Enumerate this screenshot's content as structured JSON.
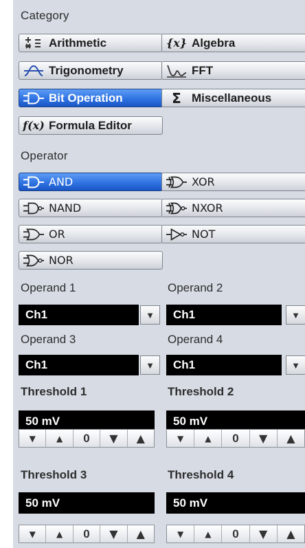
{
  "category": {
    "label": "Category",
    "items": [
      {
        "label": "Arithmetic",
        "icon": "plus-minus-icon"
      },
      {
        "label": "Algebra",
        "icon": "fx-braces-icon"
      },
      {
        "label": "Trigonometry",
        "icon": "sine-wave-icon"
      },
      {
        "label": "FFT",
        "icon": "fft-spectrum-icon"
      },
      {
        "label": "Bit Operation",
        "icon": "logic-gate-icon",
        "selected": true
      },
      {
        "label": "Miscellaneous",
        "icon": "sigma-icon"
      },
      {
        "label": "Formula Editor",
        "icon": "function-icon"
      }
    ]
  },
  "operator": {
    "label": "Operator",
    "items": [
      {
        "label": "AND",
        "icon": "and-gate-icon",
        "selected": true
      },
      {
        "label": "XOR",
        "icon": "xor-gate-icon"
      },
      {
        "label": "NAND",
        "icon": "nand-gate-icon"
      },
      {
        "label": "NXOR",
        "icon": "nxor-gate-icon"
      },
      {
        "label": "OR",
        "icon": "or-gate-icon"
      },
      {
        "label": "NOT",
        "icon": "not-gate-icon"
      },
      {
        "label": "NOR",
        "icon": "nor-gate-icon"
      }
    ]
  },
  "operands": [
    {
      "label": "Operand 1",
      "value": "Ch1"
    },
    {
      "label": "Operand 2",
      "value": "Ch1"
    },
    {
      "label": "Operand 3",
      "value": "Ch1"
    },
    {
      "label": "Operand 4",
      "value": "Ch1"
    }
  ],
  "thresholds": [
    {
      "label": "Threshold 1",
      "value": "50 mV"
    },
    {
      "label": "Threshold 2",
      "value": "50 mV"
    },
    {
      "label": "Threshold 3",
      "value": "50 mV"
    },
    {
      "label": "Threshold 4",
      "value": "50 mV"
    }
  ],
  "stepper": {
    "down": "▼",
    "up": "▲",
    "zero": "0"
  },
  "colors": {
    "panel": "#d6dbe4",
    "selected": "#2f73e2",
    "value_bg": "#000000"
  }
}
